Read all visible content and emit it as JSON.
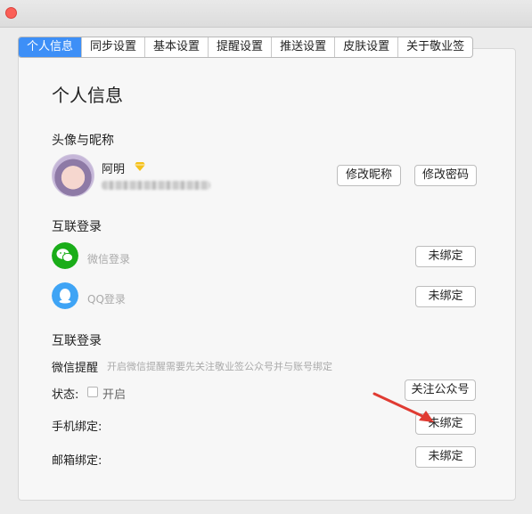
{
  "window": {
    "close_icon": "close-icon"
  },
  "tabs": [
    {
      "label": "个人信息",
      "active": true
    },
    {
      "label": "同步设置"
    },
    {
      "label": "基本设置"
    },
    {
      "label": "提醒设置"
    },
    {
      "label": "推送设置"
    },
    {
      "label": "皮肤设置"
    },
    {
      "label": "关于敬业签"
    }
  ],
  "page": {
    "title": "个人信息"
  },
  "profile": {
    "section_title": "头像与昵称",
    "nickname": "阿明",
    "edit_nickname": "修改昵称",
    "change_password": "修改密码"
  },
  "linked_login": {
    "section_title": "互联登录",
    "wechat_label": "微信登录",
    "wechat_status": "未绑定",
    "qq_label": "QQ登录",
    "qq_status": "未绑定"
  },
  "binding": {
    "section_title": "互联登录",
    "wechat_reminder_label": "微信提醒",
    "wechat_reminder_hint": "开启微信提醒需要先关注敬业签公众号并与账号绑定",
    "status_label": "状态:",
    "enable_label": "开启",
    "follow_button": "关注公众号",
    "phone_label": "手机绑定:",
    "phone_button": "未绑定",
    "email_label": "邮箱绑定:",
    "email_button": "未绑定"
  },
  "colors": {
    "accent": "#3d8ff7",
    "wechat": "#1aad19",
    "qq": "#3fa4f5",
    "arrow": "#e03b32"
  }
}
